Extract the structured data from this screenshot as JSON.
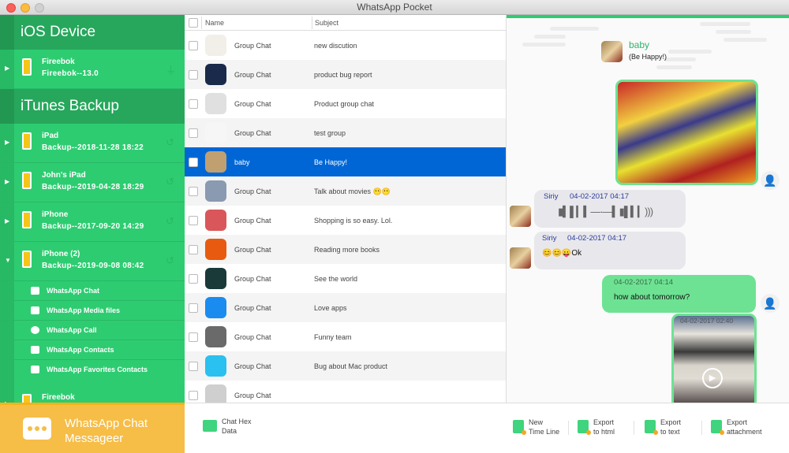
{
  "window": {
    "title": "WhatsApp Pocket"
  },
  "sidebar": {
    "ios_section": "iOS Device",
    "ios_devices": [
      {
        "name": "Fireebok",
        "sub": "Fireebok--13.0",
        "icon": "usb-icon"
      }
    ],
    "itunes_section": "iTunes Backup",
    "backups": [
      {
        "name": "iPad",
        "sub": "Backup--2018-11-28 18:22",
        "expanded": false
      },
      {
        "name": "John's iPad",
        "sub": "Backup--2019-04-28 18:29",
        "expanded": false
      },
      {
        "name": "iPhone",
        "sub": "Backup--2017-09-20 14:29",
        "expanded": false
      },
      {
        "name": "iPhone (2)",
        "sub": "Backup--2019-09-08 08:42",
        "expanded": true
      },
      {
        "name": "Fireebok",
        "sub": "",
        "expanded": false
      }
    ],
    "sub_items": [
      {
        "label": "WhatsApp Chat",
        "icon": "chat-icon"
      },
      {
        "label": "WhatsApp Media files",
        "icon": "film-icon"
      },
      {
        "label": "WhatsApp Call",
        "icon": "phone-icon"
      },
      {
        "label": "WhatsApp Contacts",
        "icon": "contact-icon"
      },
      {
        "label": "WhatsApp Favorites Contacts",
        "icon": "bookmark-icon"
      }
    ],
    "brand": {
      "line1": "WhatsApp Chat",
      "line2": "Messageer"
    }
  },
  "list": {
    "columns": [
      "Name",
      "Subject"
    ],
    "rows": [
      {
        "name": "Group Chat",
        "subject": "new discution",
        "avatar_color": "#f2efe8"
      },
      {
        "name": "Group Chat",
        "subject": "product bug report",
        "avatar_color": "#1a2a4a"
      },
      {
        "name": "Group Chat",
        "subject": "Product group chat",
        "avatar_color": "#e0e0e0"
      },
      {
        "name": "Group Chat",
        "subject": "test group",
        "avatar_color": "#f6f6f6"
      },
      {
        "name": "baby",
        "subject": "Be Happy!",
        "avatar_color": "#c0a070",
        "selected": true
      },
      {
        "name": "Group Chat",
        "subject": "Talk about movies 😶😶",
        "avatar_color": "#8a9ab0"
      },
      {
        "name": "Group Chat",
        "subject": "Shopping is so easy. Lol.",
        "avatar_color": "#d9575a"
      },
      {
        "name": "Group Chat",
        "subject": "Reading more books",
        "avatar_color": "#e85a10"
      },
      {
        "name": "Group Chat",
        "subject": "See the world",
        "avatar_color": "#1a3a3a"
      },
      {
        "name": "Group Chat",
        "subject": "Love apps",
        "avatar_color": "#1a8cf0"
      },
      {
        "name": "Group Chat",
        "subject": "Funny team",
        "avatar_color": "#6a6a6a"
      },
      {
        "name": "Group Chat",
        "subject": "Bug about Mac product",
        "avatar_color": "#2ac0f0"
      },
      {
        "name": "Group Chat",
        "subject": "",
        "avatar_color": "#cfcfcf"
      }
    ]
  },
  "chat": {
    "name": "baby",
    "status": "(Be Happy!)",
    "messages": [
      {
        "type": "image",
        "direction": "out"
      },
      {
        "type": "audio",
        "direction": "in",
        "sender": "Siriy",
        "time": "04-02-2017 04:17"
      },
      {
        "type": "text",
        "direction": "in",
        "sender": "Siriy",
        "time": "04-02-2017 04:17",
        "text": "😊😊😛Ok"
      },
      {
        "type": "text",
        "direction": "out",
        "time": "04-02-2017 04:14",
        "text": "how about tomorrow?"
      },
      {
        "type": "video",
        "direction": "out",
        "time": "04-02-2017 02:40"
      }
    ]
  },
  "toolbar": {
    "left": {
      "line1": "Chat Hex",
      "line2": "Data"
    },
    "actions": [
      {
        "line1": "New",
        "line2": "Time Line"
      },
      {
        "line1": "Export",
        "line2": "to html"
      },
      {
        "line1": "Export",
        "line2": "to text"
      },
      {
        "line1": "Export",
        "line2": "attachment"
      }
    ]
  },
  "colors": {
    "brand_green": "#2ecc71",
    "selection_blue": "#0066d6",
    "brand_orange": "#f6bd47",
    "out_bubble": "#6ee293"
  }
}
